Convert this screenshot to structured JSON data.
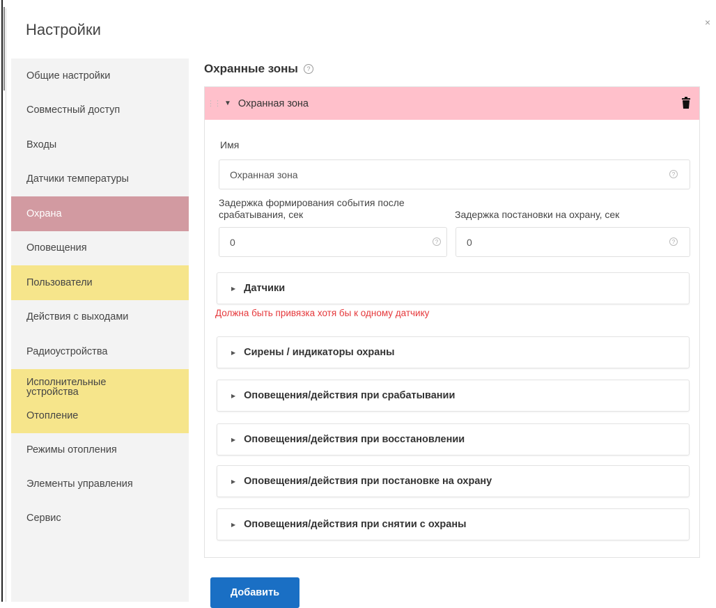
{
  "dialog": {
    "title": "Настройки",
    "close_label": "×"
  },
  "sidebar": {
    "items": [
      {
        "label": "Общие настройки"
      },
      {
        "label": "Совместный доступ"
      },
      {
        "label": "Входы"
      },
      {
        "label": "Датчики температуры"
      },
      {
        "label": "Охрана"
      },
      {
        "label": "Оповещения"
      },
      {
        "label": "Пользователи"
      },
      {
        "label": "Действия с выходами"
      },
      {
        "label": "Радиоустройства"
      },
      {
        "label": "Исполнительные устройства"
      },
      {
        "label": "Отопление"
      },
      {
        "label": "Режимы отопления"
      },
      {
        "label": "Элементы управления"
      },
      {
        "label": "Сервис"
      }
    ]
  },
  "main": {
    "section_title": "Охранные зоны",
    "help_glyph": "?",
    "zone": {
      "header": "Охранная зона",
      "name_label": "Имя",
      "name_value": "Охранная зона",
      "delay_event_label": "Задержка формирования события после срабатывания, сек",
      "delay_event_value": "0",
      "delay_arm_label": "Задержка постановки на охрану, сек",
      "delay_arm_value": "0",
      "sections": [
        {
          "label": "Датчики"
        },
        {
          "label": "Сирены / индикаторы охраны"
        },
        {
          "label": "Оповещения/действия при срабатывании"
        },
        {
          "label": "Оповещения/действия при восстановлении"
        },
        {
          "label": "Оповещения/действия при постановке на охрану"
        },
        {
          "label": "Оповещения/действия при снятии с охраны"
        }
      ],
      "error": "Должна быть привязка хотя бы к одному датчику"
    },
    "add_button": "Добавить"
  },
  "colors": {
    "active_item": "#d29aa1",
    "highlight_item": "#f6e58b",
    "zone_header": "#ffc0cb",
    "error": "#e5383b",
    "primary": "#1a6fc4"
  }
}
